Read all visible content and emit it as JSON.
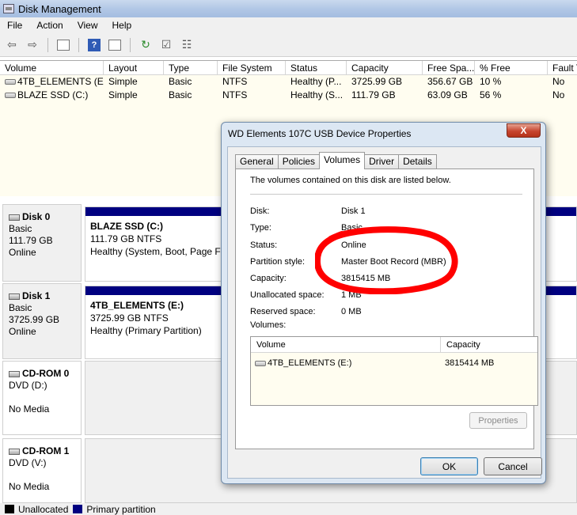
{
  "window": {
    "title": "Disk Management"
  },
  "menu": [
    "File",
    "Action",
    "View",
    "Help"
  ],
  "volume_list": {
    "columns": [
      "Volume",
      "Layout",
      "Type",
      "File System",
      "Status",
      "Capacity",
      "Free Spa...",
      "% Free",
      "Fault T"
    ],
    "rows": [
      [
        "4TB_ELEMENTS (E:)",
        "Simple",
        "Basic",
        "NTFS",
        "Healthy (P...",
        "3725.99 GB",
        "356.67 GB",
        "10 %",
        "No"
      ],
      [
        "BLAZE SSD (C:)",
        "Simple",
        "Basic",
        "NTFS",
        "Healthy (S...",
        "111.79 GB",
        "63.09 GB",
        "56 %",
        "No"
      ]
    ]
  },
  "disks": [
    {
      "name": "Disk 0",
      "type": "Basic",
      "size": "111.79 GB",
      "status": "Online",
      "partition": {
        "name": "BLAZE SSD  (C:)",
        "size": "111.79 GB NTFS",
        "status": "Healthy (System, Boot, Page Fil"
      }
    },
    {
      "name": "Disk 1",
      "type": "Basic",
      "size": "3725.99 GB",
      "status": "Online",
      "partition": {
        "name": "4TB_ELEMENTS  (E:)",
        "size": "3725.99 GB NTFS",
        "status": "Healthy (Primary Partition)"
      }
    },
    {
      "name": "CD-ROM 0",
      "type": "DVD (D:)",
      "status": "No Media"
    },
    {
      "name": "CD-ROM 1",
      "type": "DVD (V:)",
      "status": "No Media"
    }
  ],
  "legend": {
    "unallocated": "Unallocated",
    "primary": "Primary partition"
  },
  "colors": {
    "primary": "#000080",
    "unallocated": "#000000",
    "annotation": "#ff0000"
  },
  "dialog": {
    "title": "WD Elements 107C USB Device Properties",
    "close": "X",
    "tabs": [
      "General",
      "Policies",
      "Volumes",
      "Driver",
      "Details"
    ],
    "active_tab": "Volumes",
    "intro": "The volumes contained on this disk are listed below.",
    "fields": [
      {
        "label": "Disk:",
        "value": "Disk 1"
      },
      {
        "label": "Type:",
        "value": "Basic"
      },
      {
        "label": "Status:",
        "value": "Online"
      },
      {
        "label": "Partition style:",
        "value": "Master Boot Record (MBR)"
      },
      {
        "label": "Capacity:",
        "value": "3815415 MB"
      },
      {
        "label": "Unallocated space:",
        "value": "1 MB"
      },
      {
        "label": "Reserved space:",
        "value": "0 MB"
      }
    ],
    "volumes_label": "Volumes:",
    "volumes_columns": [
      "Volume",
      "Capacity"
    ],
    "volumes_rows": [
      {
        "volume": "4TB_ELEMENTS (E:)",
        "capacity": "3815414 MB"
      }
    ],
    "properties_button": "Properties",
    "ok_button": "OK",
    "cancel_button": "Cancel"
  }
}
